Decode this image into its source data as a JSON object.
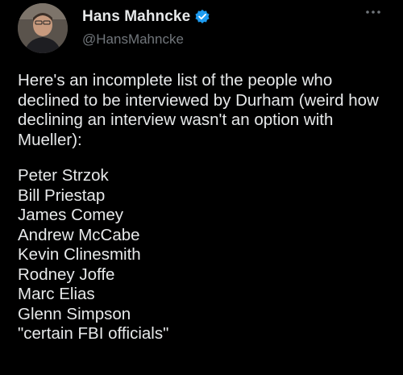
{
  "tweet": {
    "author": {
      "display_name": "Hans Mahncke",
      "handle": "@HansMahncke",
      "verified": true,
      "avatar_icon": "profile-photo",
      "verified_icon": "verified-badge-icon",
      "verified_color": "#1d9bf0"
    },
    "more_icon": "more-options-icon",
    "intro_text": "Here's an incomplete list of the people who declined to be interviewed by Durham (weird how declining an interview wasn't an option with Mueller):",
    "names": [
      "Peter Strzok",
      "Bill Priestap",
      "James Comey",
      "Andrew McCabe",
      "Kevin Clinesmith",
      "Rodney Joffe",
      "Marc Elias",
      "Glenn Simpson",
      "\"certain FBI officials\""
    ]
  },
  "theme": {
    "background": "#000000",
    "text": "#e7e9ea",
    "secondary_text": "#71767b"
  }
}
